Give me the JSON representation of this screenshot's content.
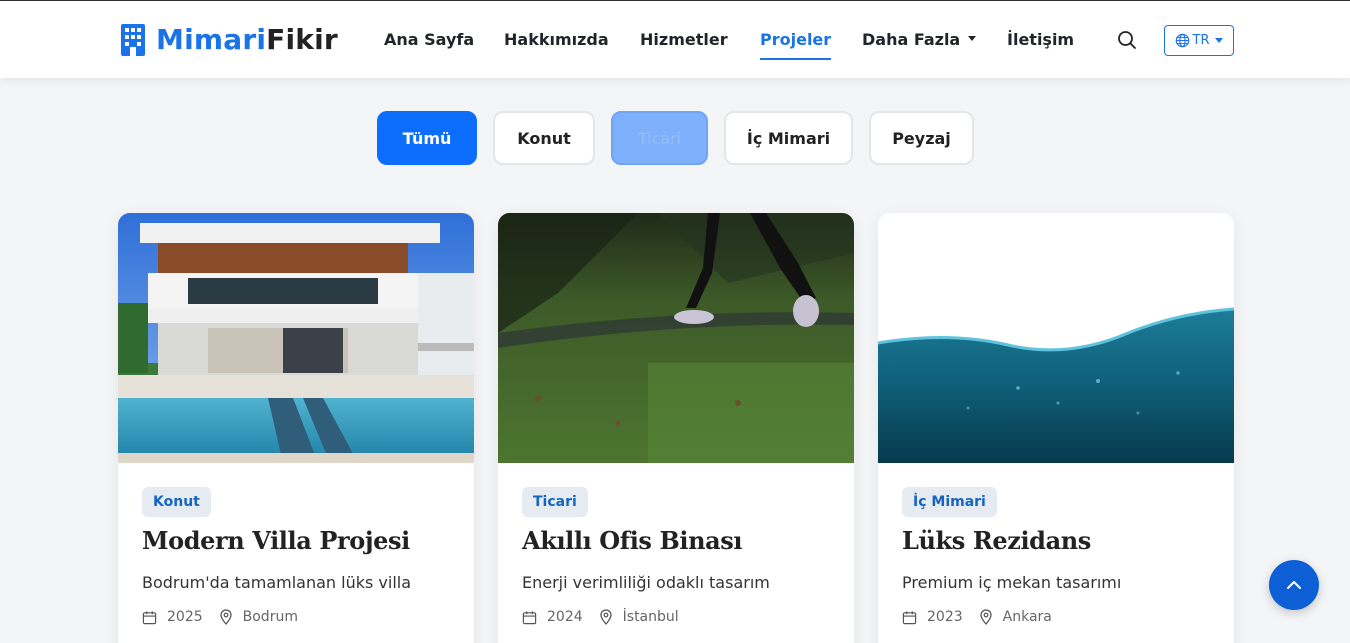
{
  "brand": {
    "part1": "Mimari",
    "part2": "Fikir",
    "icon": "building-icon",
    "color": "#1a73e8"
  },
  "nav": {
    "items": [
      {
        "label": "Ana Sayfa",
        "active": false
      },
      {
        "label": "Hakkımızda",
        "active": false
      },
      {
        "label": "Hizmetler",
        "active": false
      },
      {
        "label": "Projeler",
        "active": true
      },
      {
        "label": "Daha Fazla",
        "active": false,
        "dropdown": true
      },
      {
        "label": "İletişim",
        "active": false
      }
    ],
    "search_icon": "search-icon",
    "language": {
      "label": "TR",
      "icon": "globe-icon"
    }
  },
  "filters": {
    "items": [
      {
        "label": "Tümü",
        "state": "active"
      },
      {
        "label": "Konut",
        "state": "default"
      },
      {
        "label": "Ticari",
        "state": "faded"
      },
      {
        "label": "İç Mimari",
        "state": "default"
      },
      {
        "label": "Peyzaj",
        "state": "default"
      }
    ]
  },
  "projects": [
    {
      "category": "Konut",
      "title": "Modern Villa Projesi",
      "description": "Bodrum'da tamamlanan lüks villa",
      "year": "2025",
      "location": "Bodrum",
      "image": "villa-photo"
    },
    {
      "category": "Ticari",
      "title": "Akıllı Ofis Binası",
      "description": "Enerji verimliliği odaklı tasarım",
      "year": "2024",
      "location": "İstanbul",
      "image": "grass-walk-photo"
    },
    {
      "category": "İç Mimari",
      "title": "Lüks Rezidans",
      "description": "Premium iç mekan tasarımı",
      "year": "2023",
      "location": "Ankara",
      "image": "water-wave-photo"
    }
  ],
  "scroll_top_icon": "chevron-up-icon",
  "colors": {
    "primary": "#0d6efd",
    "badge_bg": "#e6eaf1",
    "badge_text": "#1565c0"
  }
}
